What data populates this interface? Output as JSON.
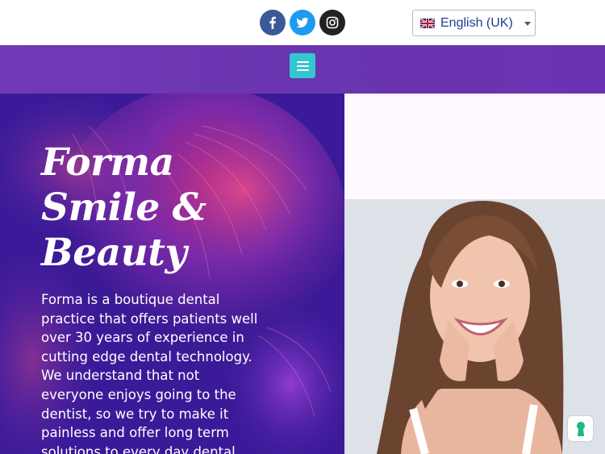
{
  "header": {
    "social": [
      {
        "name": "facebook",
        "icon": "facebook-icon",
        "color": "#3b5998"
      },
      {
        "name": "twitter",
        "icon": "twitter-icon",
        "color": "#1d9bf0"
      },
      {
        "name": "instagram",
        "icon": "instagram-icon",
        "color": "#222222"
      }
    ],
    "language": {
      "selected": "English (UK)",
      "flag_icon": "uk-flag-icon"
    }
  },
  "nav": {
    "menu_icon": "hamburger-menu-icon",
    "menu_color": "#33c7cf",
    "bar_color": "#6a35b0"
  },
  "hero": {
    "title_lines": [
      "Forma",
      "Smile &",
      "Beauty"
    ],
    "description": "Forma is a boutique dental practice that offers patients well over 30 years of experience in cutting edge dental technology. We understand that not everyone enjoys going to the dentist, so we try to make it painless and offer long term solutions to every day dental"
  },
  "widgets": {
    "cookie_icon": "keyhole-icon",
    "cookie_color": "#20b58a"
  }
}
